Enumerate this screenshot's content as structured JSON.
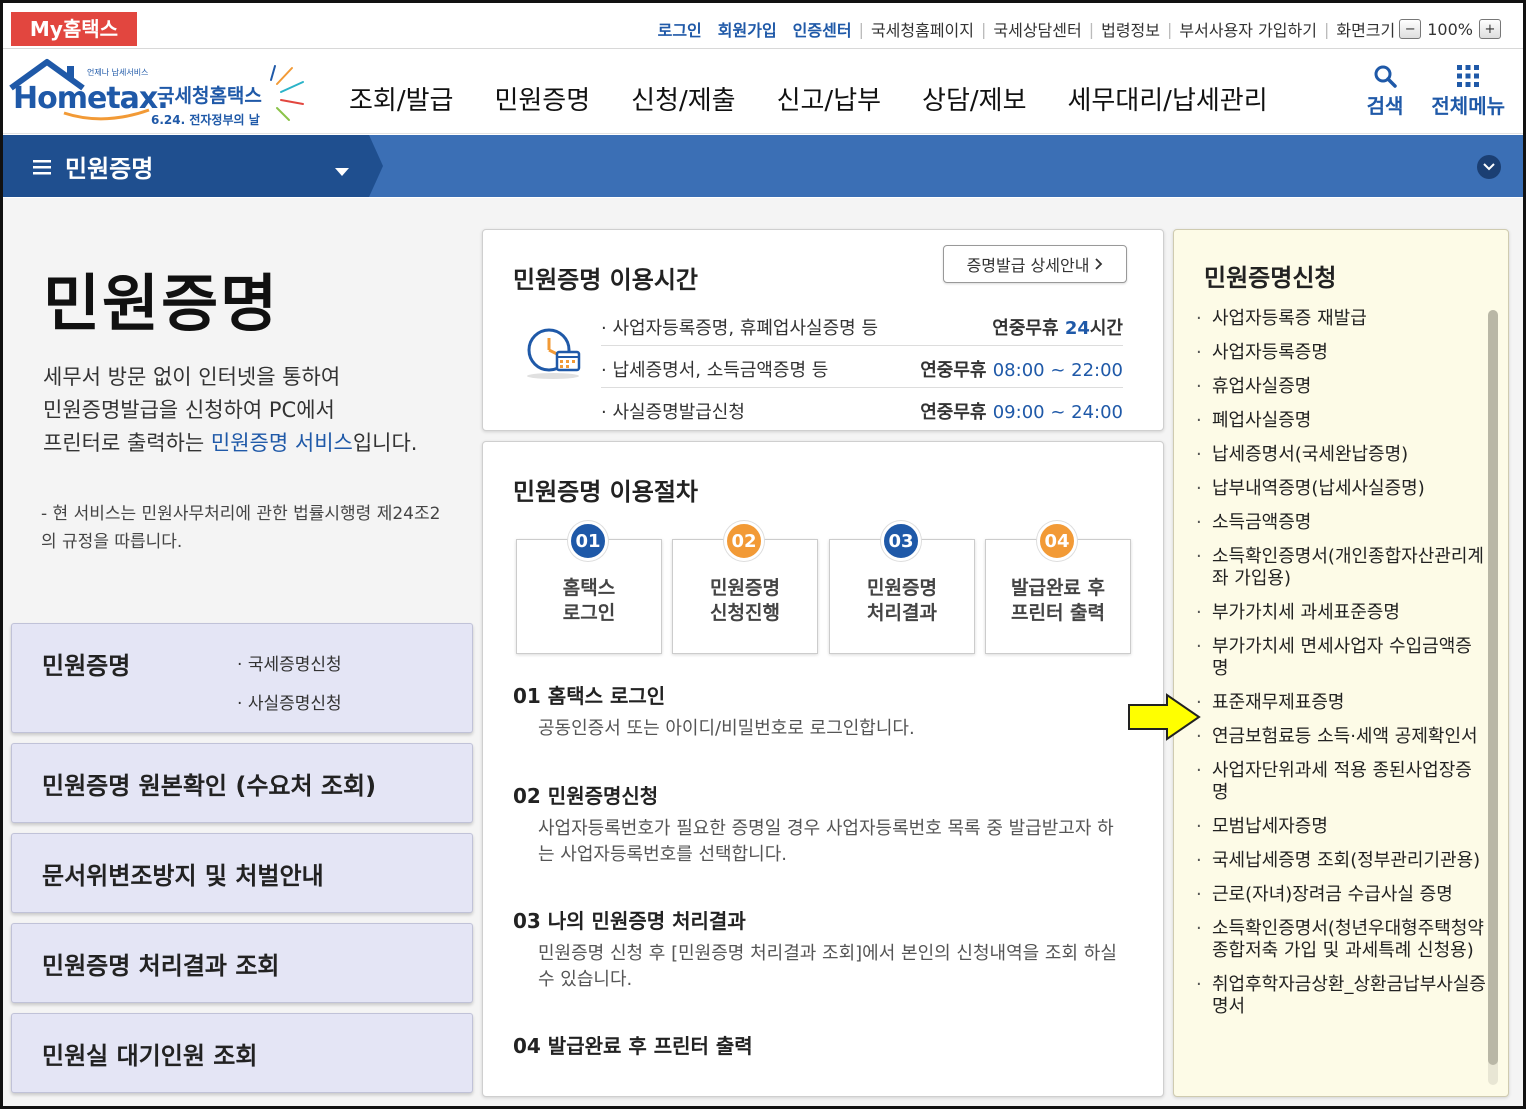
{
  "topbar": {
    "my_hometax": "My홈택스",
    "links_highlight": [
      "로그인",
      "회원가입",
      "인증센터"
    ],
    "links_plain": [
      "국세청홈페이지",
      "국세상담센터",
      "법령정보",
      "부서사용자 가입하기",
      "화면크기"
    ],
    "zoom_minus": "−",
    "zoom_value": "100%",
    "zoom_plus": "+"
  },
  "logo": {
    "small_text": "언제나 납세서비스",
    "brand": "Hometax",
    "brand_kr": "국세청홈택스",
    "sub": "6.24. 전자정부의 날"
  },
  "gnb": {
    "menu": [
      "조회/발급",
      "민원증명",
      "신청/제출",
      "신고/납부",
      "상담/제보",
      "세무대리/납세관리"
    ],
    "search": "검색",
    "all_menu": "전체메뉴"
  },
  "subnav": {
    "title": "민원증명"
  },
  "intro": {
    "title": "민원증명",
    "line1": "세무서 방문 없이 인터넷을 통하여",
    "line2": "민원증명발급을 신청하여 PC에서",
    "line3_pre": "프린터로 출력하는 ",
    "line3_link": "민원증명 서비스",
    "line3_post": "입니다.",
    "note": "- 현 서비스는 민원사무처리에 관한 법률시행령 제24조2의 규정을 따릅니다."
  },
  "left_menu": {
    "box1_title": "민원증명",
    "box1_subs": [
      "국세증명신청",
      "사실증명신청"
    ],
    "box2": "민원증명 원본확인 (수요처 조회)",
    "box3": "문서위변조방지 및 처벌안내",
    "box4": "민원증명 처리결과 조회",
    "box5": "민원실 대기인원 조회"
  },
  "hours": {
    "title": "민원증명 이용시간",
    "detail_btn": "증명발급 상세안내",
    "rows": [
      {
        "label": "사업자등록증명, 휴폐업사실증명 등",
        "prefix": "연중무휴 ",
        "time": "24",
        "suffix": "시간"
      },
      {
        "label": "납세증명서, 소득금액증명 등",
        "prefix": "연중무휴 ",
        "time": "08:00 ~ 22:00",
        "suffix": ""
      },
      {
        "label": "사실증명발급신청",
        "prefix": "연중무휴 ",
        "time": "09:00 ~ 24:00",
        "suffix": ""
      }
    ]
  },
  "procedure": {
    "title": "민원증명 이용절차",
    "steps": [
      {
        "num": "01",
        "line1": "홈택스",
        "line2": "로그인"
      },
      {
        "num": "02",
        "line1": "민원증명",
        "line2": "신청진행"
      },
      {
        "num": "03",
        "line1": "민원증명",
        "line2": "처리결과"
      },
      {
        "num": "04",
        "line1": "발급완료 후",
        "line2": "프린터 출력"
      }
    ],
    "details": [
      {
        "head": "01 홈택스 로그인",
        "desc": "공동인증서 또는 아이디/비밀번호로 로그인합니다."
      },
      {
        "head": "02 민원증명신청",
        "desc": "사업자등록번호가 필요한 증명일 경우 사업자등록번호 목록 중 발급받고자 하는 사업자등록번호를 선택합니다."
      },
      {
        "head": "03 나의 민원증명 처리결과",
        "desc": "민원증명 신청 후 [민원증명 처리결과 조회]에서 본인의 신청내역을 조회 하실 수 있습니다."
      },
      {
        "head": "04 발급완료 후 프린터 출력",
        "desc": ""
      }
    ]
  },
  "apply": {
    "title": "민원증명신청",
    "items": [
      "사업자등록증 재발급",
      "사업자등록증명",
      "휴업사실증명",
      "폐업사실증명",
      "납세증명서(국세완납증명)",
      "납부내역증명(납세사실증명)",
      "소득금액증명",
      "소득확인증명서(개인종합자산관리계좌 가입용)",
      "부가가치세 과세표준증명",
      "부가가치세 면세사업자 수입금액증명",
      "표준재무제표증명",
      "연금보험료등 소득·세액 공제확인서",
      "사업자단위과세 적용 종된사업장증명",
      "모범납세자증명",
      "국세납세증명 조회(정부관리기관용)",
      "근로(자녀)장려금 수급사실 증명",
      "소득확인증명서(청년우대형주택청약종합저축 가입 및 과세특례 신청용)",
      "취업후학자금상환_상환금납부사실증명서"
    ]
  },
  "colors": {
    "brand_blue": "#1f59a8",
    "accent_orange": "#f29a36",
    "subnav_blue": "#3b6fb5",
    "my_red": "#e2463f",
    "arrow_yellow": "#ffff00"
  }
}
